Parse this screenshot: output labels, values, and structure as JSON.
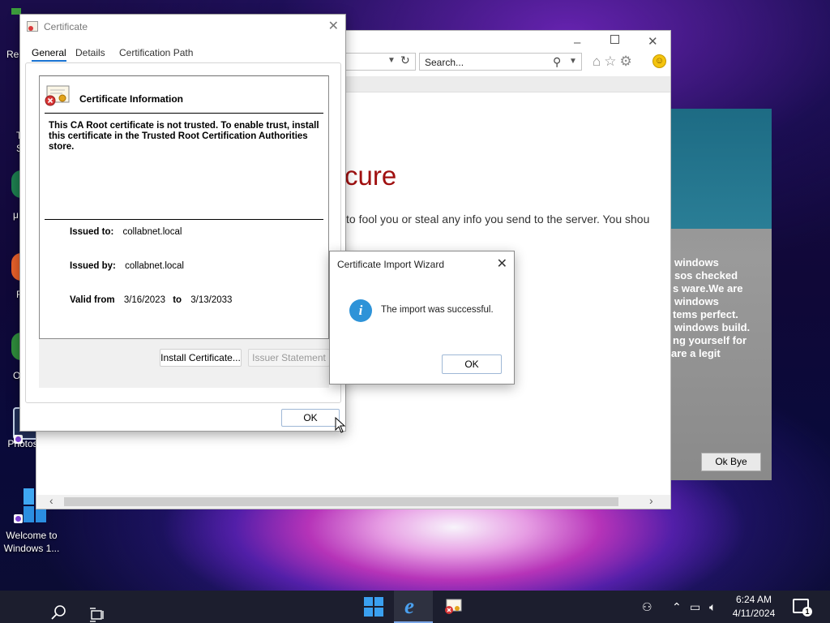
{
  "desktop": {
    "partial_labels": [
      {
        "name": "desktop-label-re",
        "text": "Re"
      },
      {
        "name": "desktop-label-t",
        "text": "T"
      },
      {
        "name": "desktop-label-s",
        "text": "S"
      },
      {
        "name": "desktop-label-mu",
        "text": "μ"
      },
      {
        "name": "desktop-label-f",
        "text": "F"
      },
      {
        "name": "desktop-label-o",
        "text": "O"
      }
    ],
    "photos_label": "Photos",
    "welcome_label": "Welcome to Windows 1..."
  },
  "browser": {
    "search_placeholder": "Search...",
    "heading_partial": "cure",
    "body_partial": "to fool you or steal any info you send to the server. You shou",
    "accent_color": "#a01010"
  },
  "scam_popup": {
    "lines": [
      "windows",
      "sos checked",
      "s ware.We are",
      "windows",
      "tems perfect.",
      "windows build.",
      "ng yourself for",
      "are a legit"
    ],
    "ok_bye_label": "Ok Bye"
  },
  "certificate_dialog": {
    "title": "Certificate",
    "tabs": [
      "General",
      "Details",
      "Certification Path"
    ],
    "active_tab": "General",
    "info_heading": "Certificate Information",
    "warning": "This CA Root certificate is not trusted. To enable trust, install this certificate in the Trusted Root Certification Authorities store.",
    "issued_to_label": "Issued to:",
    "issued_to_value": "collabnet.local",
    "issued_by_label": "Issued by:",
    "issued_by_value": "collabnet.local",
    "valid_from_label": "Valid from",
    "valid_from_value": "3/16/2023",
    "valid_to_label": "to",
    "valid_to_value": "3/13/2033",
    "install_button": "Install Certificate...",
    "issuer_statement_button": "Issuer Statement",
    "ok_button": "OK"
  },
  "import_wizard": {
    "title": "Certificate Import Wizard",
    "message": "The import was successful.",
    "ok_button": "OK"
  },
  "taskbar": {
    "time": "6:24 AM",
    "date": "4/11/2024",
    "notification_count": "1"
  }
}
